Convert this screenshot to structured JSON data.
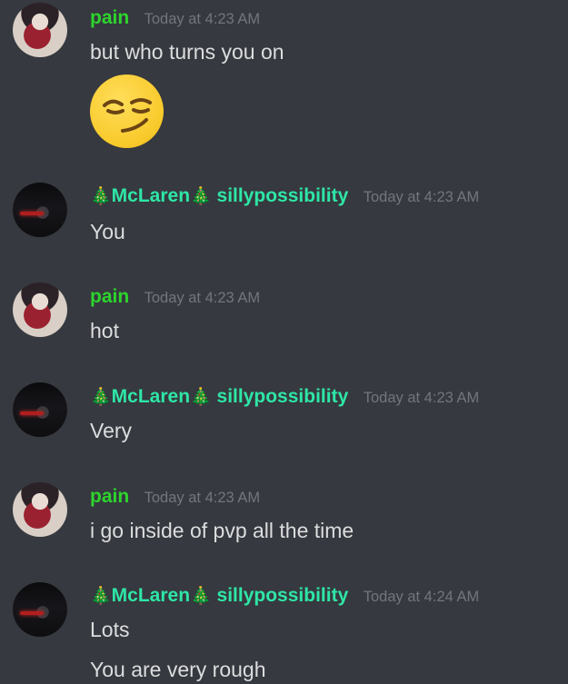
{
  "messages": [
    {
      "author": "pain",
      "timestamp": "Today at 4:23 AM",
      "lines": [
        "but who turns you on"
      ],
      "emoji": "smirking-face"
    },
    {
      "author_prefix": "🎄",
      "author": "McLaren",
      "author_mid": "🎄",
      "author_suffix": " sillypossibility",
      "timestamp": "Today at 4:23 AM",
      "lines": [
        "You"
      ]
    },
    {
      "author": "pain",
      "timestamp": "Today at 4:23 AM",
      "lines": [
        "hot"
      ]
    },
    {
      "author_prefix": "🎄",
      "author": "McLaren",
      "author_mid": "🎄",
      "author_suffix": " sillypossibility",
      "timestamp": "Today at 4:23 AM",
      "lines": [
        "Very"
      ]
    },
    {
      "author": "pain",
      "timestamp": "Today at 4:23 AM",
      "lines": [
        "i go inside of pvp all the time"
      ]
    },
    {
      "author_prefix": "🎄",
      "author": "McLaren",
      "author_mid": "🎄",
      "author_suffix": " sillypossibility",
      "timestamp": "Today at 4:24 AM",
      "lines": [
        "Lots",
        "You are very rough"
      ]
    }
  ]
}
